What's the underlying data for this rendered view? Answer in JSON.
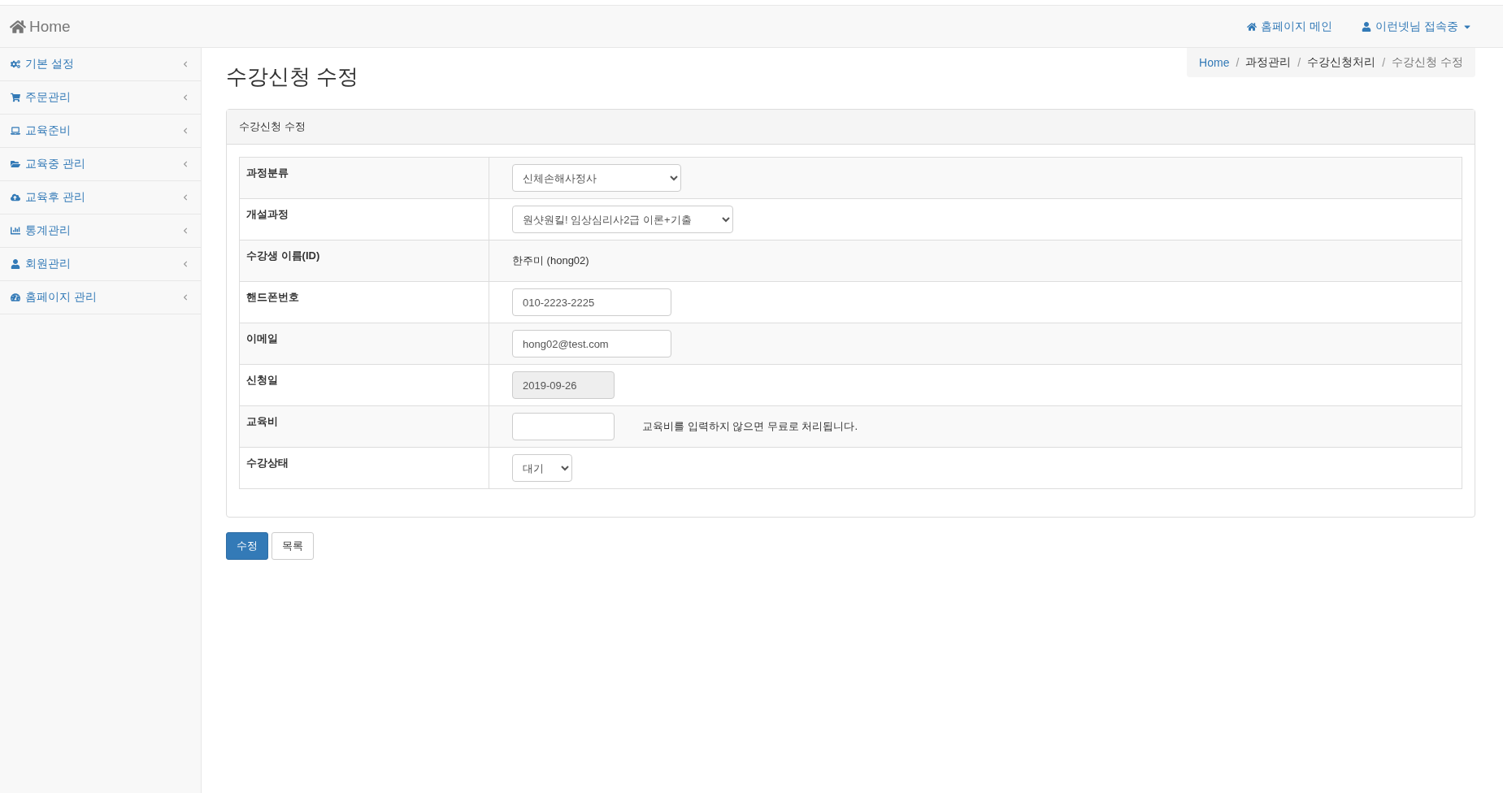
{
  "navbar": {
    "brand": "Home",
    "links": [
      {
        "kind": "home",
        "label": "홈페이지 메인"
      },
      {
        "kind": "user",
        "label": "이런넷님 접속중"
      }
    ]
  },
  "sidebar": {
    "items": [
      {
        "label": "기본 설정",
        "expanded": false
      },
      {
        "label": "주문관리",
        "expanded": false
      },
      {
        "label": "교육준비",
        "expanded": false
      },
      {
        "label": "교육중 관리",
        "expanded": false
      },
      {
        "label": "교육후 관리",
        "expanded": false
      },
      {
        "label": "통계관리",
        "expanded": false
      },
      {
        "label": "회원관리",
        "expanded": false
      },
      {
        "label": "홈페이지 관리",
        "expanded": false
      }
    ]
  },
  "page": {
    "title": "수강신청 수정",
    "breadcrumb_separator": "/",
    "breadcrumb": [
      {
        "label": "Home",
        "kind": "link"
      },
      {
        "label": "과정관리",
        "kind": "text"
      },
      {
        "label": "수강신청처리",
        "kind": "text"
      },
      {
        "label": "수강신청 수정",
        "kind": "active"
      }
    ]
  },
  "panel": {
    "heading": "수강신청 수정",
    "rows": [
      {
        "label": "과정분류",
        "kind": "select",
        "value": "신체손해사정사"
      },
      {
        "label": "개설과정",
        "kind": "select",
        "value": "원샷원킬! 임상심리사2급 이론+기출"
      },
      {
        "label": "수강생 이름(ID)",
        "kind": "text",
        "value": "한주미 (hong02)"
      },
      {
        "label": "핸드폰번호",
        "kind": "input",
        "value": "010-2223-2225",
        "disabled": false
      },
      {
        "label": "이메일",
        "kind": "input",
        "value": "hong02@test.com",
        "disabled": false
      },
      {
        "label": "신청일",
        "kind": "input",
        "value": "2019-09-26",
        "disabled": true
      },
      {
        "label": "교육비",
        "kind": "input",
        "value": "",
        "disabled": false,
        "note": "교육비를 입력하지 않으면 무료로 처리됩니다."
      },
      {
        "label": "수강상태",
        "kind": "select",
        "value": "대기"
      }
    ]
  },
  "buttons": [
    {
      "label": "수정",
      "kind": "primary"
    },
    {
      "label": "목록",
      "kind": "default"
    }
  ]
}
